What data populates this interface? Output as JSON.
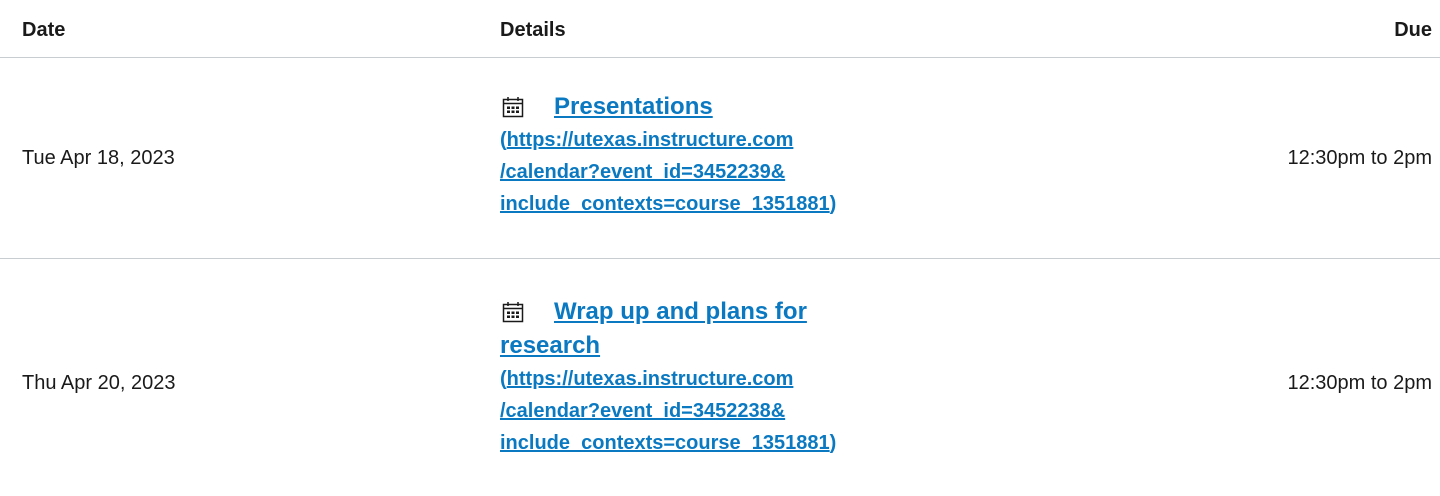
{
  "headers": {
    "date": "Date",
    "details": "Details",
    "due": "Due"
  },
  "rows": [
    {
      "date": "Tue Apr 18, 2023",
      "icon": "calendar-icon",
      "title": "Presentations",
      "title_cont": "",
      "url_lines": [
        "https://utexas.instructure.com",
        "/calendar?event_id=3452239&",
        "include_contexts=course_1351881"
      ],
      "open_paren": "(",
      "close_paren": ")",
      "due": "12:30pm to 2pm"
    },
    {
      "date": "Thu Apr 20, 2023",
      "icon": "calendar-icon",
      "title": "Wrap up and plans for",
      "title_cont": "research",
      "url_lines": [
        "https://utexas.instructure.com",
        "/calendar?event_id=3452238&",
        "include_contexts=course_1351881"
      ],
      "open_paren": "(",
      "close_paren": ")",
      "due": "12:30pm to 2pm"
    }
  ],
  "colors": {
    "link": "#0b79c1",
    "divider": "#c7cdd1",
    "text": "#1a1a1a"
  }
}
